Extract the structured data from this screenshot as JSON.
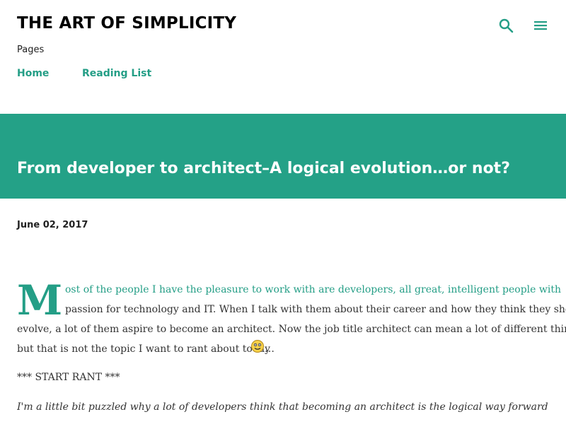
{
  "header": {
    "blog_title": "THE ART OF SIMPLICITY",
    "pages_label": "Pages",
    "nav": [
      {
        "label": "Home"
      },
      {
        "label": "Reading List"
      }
    ],
    "icons": {
      "search": "search-icon",
      "menu": "hamburger-menu-icon"
    },
    "accent_color": "#249e86"
  },
  "post": {
    "title": "From developer to architect–A logical evolution…or not?",
    "date": "June 02, 2017",
    "banner_color": "#24a187",
    "body": {
      "dropcap": "M",
      "line1": "ost of the people I have the pleasure to work with are developers, all great, intelligent people with",
      "line2": "passion for technology and IT. When I talk with them about their career and how they think they should",
      "line3": "evolve, a lot of them aspire to become an architect. Now the job title architect can mean a lot of different things,",
      "line4": "but that is not the topic I want to rant about today",
      "line4_end": "…",
      "emoticon": "smiley-emoticon",
      "rant_start": "*** START RANT ***",
      "italic_line": "I'm a little bit puzzled why a lot of developers think that becoming an architect is the logical way forward. Why you"
    }
  }
}
